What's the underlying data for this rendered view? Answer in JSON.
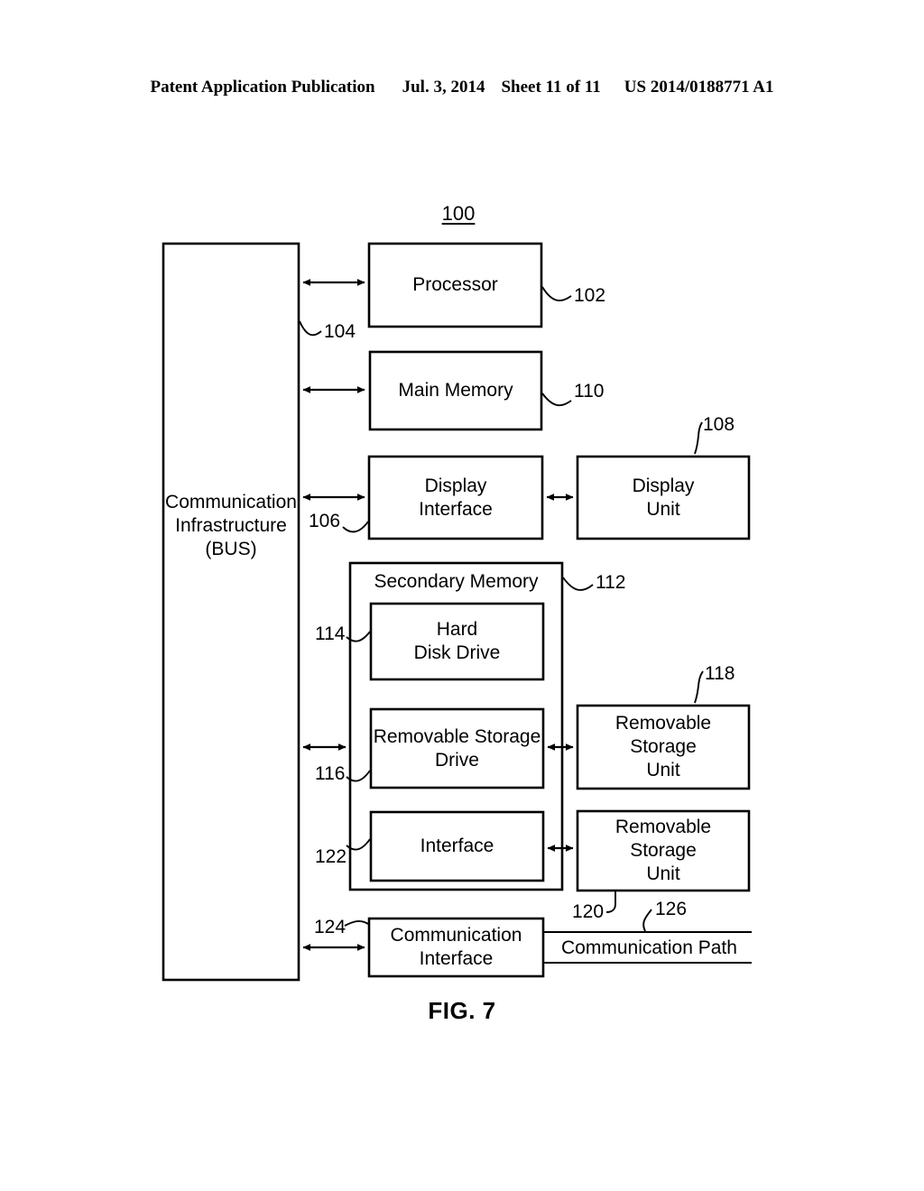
{
  "header": {
    "publication": "Patent Application Publication",
    "date": "Jul. 3, 2014",
    "sheet": "Sheet 11 of 11",
    "patent_number": "US 2014/0188771 A1"
  },
  "figure": {
    "title": "FIG. 7",
    "system_number": "100"
  },
  "blocks": {
    "bus": "Communication\nInfrastructure\n(BUS)",
    "processor": "Processor",
    "main_memory": "Main Memory",
    "display_interface": "Display\nInterface",
    "display_unit": "Display\nUnit",
    "secondary_memory": "Secondary Memory",
    "hard_disk_drive": "Hard\nDisk Drive",
    "removable_storage_drive": "Removable Storage\nDrive",
    "removable_storage_unit_1": "Removable\nStorage\nUnit",
    "interface": "Interface",
    "removable_storage_unit_2": "Removable\nStorage\nUnit",
    "communication_interface": "Communication\nInterface",
    "communication_path": "Communication Path"
  },
  "reference_numerals": {
    "processor": "102",
    "bus": "104",
    "display_interface": "106",
    "display_unit": "108",
    "main_memory": "110",
    "secondary_memory": "112",
    "hard_disk_drive": "114",
    "removable_storage_drive": "116",
    "removable_storage_unit_1": "118",
    "removable_storage_unit_2": "120",
    "interface": "122",
    "communication_interface": "124",
    "communication_path": "126"
  },
  "colors": {
    "ink": "#000000",
    "background": "#ffffff"
  }
}
